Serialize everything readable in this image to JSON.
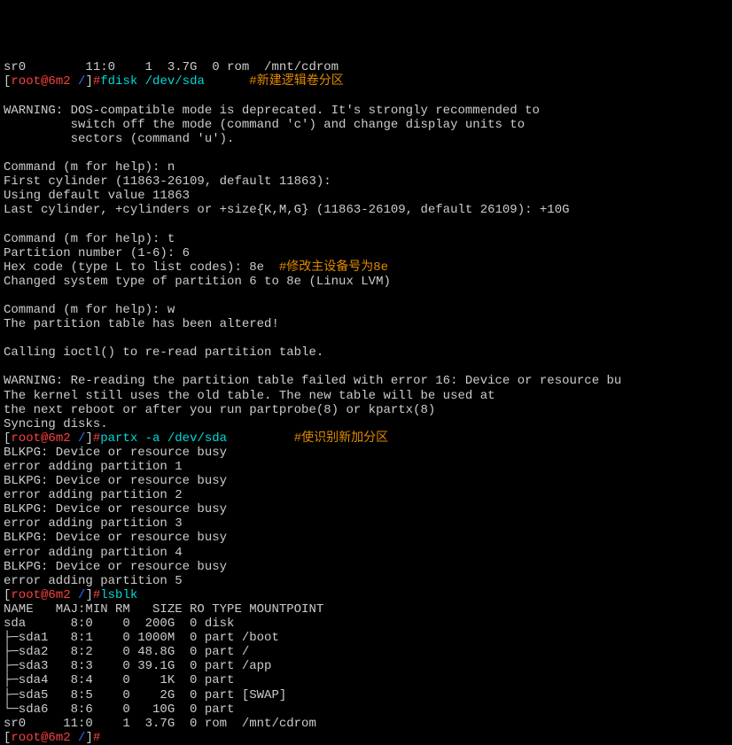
{
  "top_line": "sr0        11:0    1  3.7G  0 rom  /mnt/cdrom",
  "p1": {
    "user": "root@6m2",
    "path": " /",
    "hash": "#"
  },
  "cmd1": "fdisk /dev/sda",
  "ann1": "#新建逻辑卷分区",
  "block1": "WARNING: DOS-compatible mode is deprecated. It's strongly recommended to\n         switch off the mode (command 'c') and change display units to\n         sectors (command 'u').\n\nCommand (m for help): n\nFirst cylinder (11863-26109, default 11863):\nUsing default value 11863\nLast cylinder, +cylinders or +size{K,M,G} (11863-26109, default 26109): +10G\n\nCommand (m for help): t\nPartition number (1-6): 6\nHex code (type L to list codes): 8e",
  "ann2": "#修改主设备号为8e",
  "block2": "Changed system type of partition 6 to 8e (Linux LVM)\n\nCommand (m for help): w\nThe partition table has been altered!\n\nCalling ioctl() to re-read partition table.\n\nWARNING: Re-reading the partition table failed with error 16: Device or resource bu\nThe kernel still uses the old table. The new table will be used at\nthe next reboot or after you run partprobe(8) or kpartx(8)\nSyncing disks.",
  "p2": {
    "user": "root@6m2",
    "path": " /",
    "hash": "#"
  },
  "cmd2": "partx -a /dev/sda",
  "ann3": "#使识别新加分区",
  "block3": "BLKPG: Device or resource busy\nerror adding partition 1\nBLKPG: Device or resource busy\nerror adding partition 2\nBLKPG: Device or resource busy\nerror adding partition 3\nBLKPG: Device or resource busy\nerror adding partition 4\nBLKPG: Device or resource busy\nerror adding partition 5",
  "p3": {
    "user": "root@6m2",
    "path": " /",
    "hash": "#"
  },
  "cmd3": "lsblk",
  "lsblk_header": "NAME   MAJ:MIN RM   SIZE RO TYPE MOUNTPOINT",
  "lsblk_rows": [
    "sda      8:0    0  200G  0 disk",
    "├─sda1   8:1    0 1000M  0 part /boot",
    "├─sda2   8:2    0 48.8G  0 part /",
    "├─sda3   8:3    0 39.1G  0 part /app",
    "├─sda4   8:4    0    1K  0 part",
    "├─sda5   8:5    0    2G  0 part [SWAP]",
    "└─sda6   8:6    0   10G  0 part",
    "sr0     11:0    1  3.7G  0 rom  /mnt/cdrom"
  ],
  "p4": {
    "user": "root@6m2",
    "path": " /",
    "hash": "#"
  }
}
